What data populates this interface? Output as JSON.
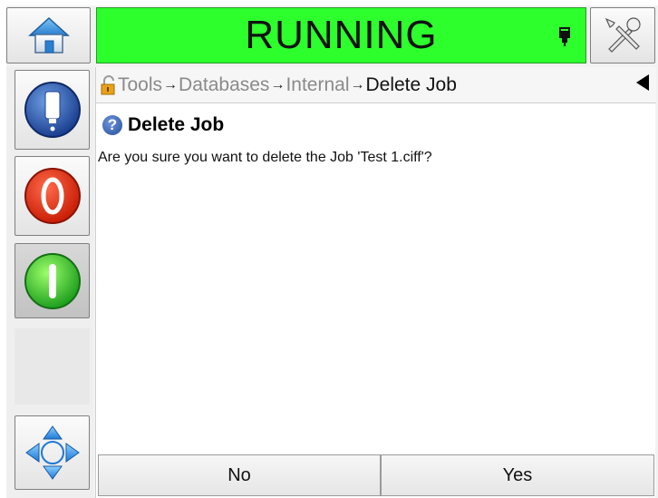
{
  "status": {
    "text": "RUNNING",
    "color": "#2cff2c"
  },
  "toolbar": {
    "home_icon": "home-icon",
    "tools_icon": "tools-icon",
    "printhead_icon": "printhead-icon"
  },
  "sidebar": {
    "items": [
      {
        "icon": "ink-system-icon"
      },
      {
        "icon": "stop-icon"
      },
      {
        "icon": "start-icon"
      },
      {
        "icon": "navigation-arrows-icon"
      }
    ]
  },
  "breadcrumb": {
    "items": [
      "Tools",
      "Databases",
      "Internal"
    ],
    "current": "Delete Job",
    "separator": "→"
  },
  "dialog": {
    "title": "Delete Job",
    "message": "Are you sure you want to delete the Job 'Test 1.ciff'?",
    "help_symbol": "?"
  },
  "actions": {
    "no_label": "No",
    "yes_label": "Yes"
  }
}
